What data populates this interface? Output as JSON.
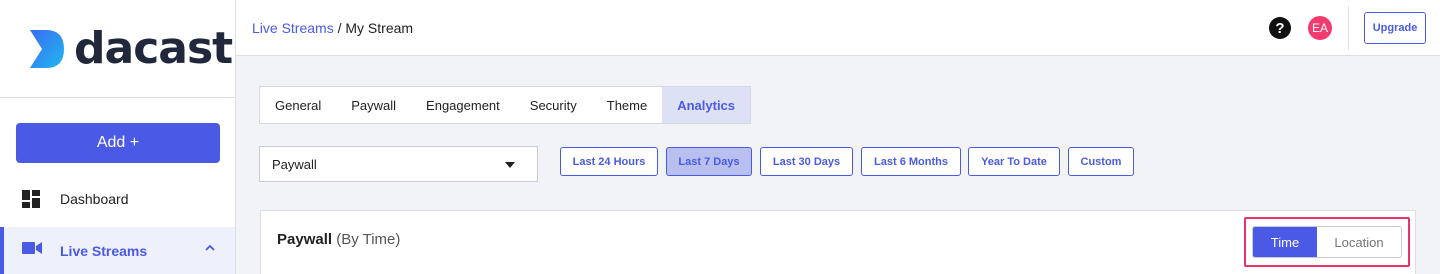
{
  "brand": {
    "name": "dacast",
    "accent": "#4b5ae4"
  },
  "sidebar": {
    "add_button": "Add +",
    "items": [
      {
        "label": "Dashboard",
        "icon": "dashboard-icon"
      },
      {
        "label": "Live Streams",
        "icon": "video-camera-icon",
        "active": true
      }
    ]
  },
  "header": {
    "breadcrumb": {
      "link": "Live Streams",
      "separator": " / ",
      "current": "My Stream"
    },
    "help_glyph": "?",
    "avatar_initials": "EA",
    "upgrade_label": "Upgrade"
  },
  "tabs": [
    {
      "label": "General"
    },
    {
      "label": "Paywall"
    },
    {
      "label": "Engagement"
    },
    {
      "label": "Security"
    },
    {
      "label": "Theme"
    },
    {
      "label": "Analytics",
      "active": true
    }
  ],
  "filters": {
    "select_value": "Paywall",
    "ranges": [
      {
        "label": "Last 24 Hours"
      },
      {
        "label": "Last 7 Days",
        "active": true
      },
      {
        "label": "Last 30 Days"
      },
      {
        "label": "Last 6 Months"
      },
      {
        "label": "Year To Date"
      },
      {
        "label": "Custom"
      }
    ]
  },
  "panel": {
    "title": "Paywall",
    "subtitle": "(By Time)",
    "toggle": {
      "time_label": "Time",
      "location_label": "Location",
      "selected": "Time"
    }
  }
}
